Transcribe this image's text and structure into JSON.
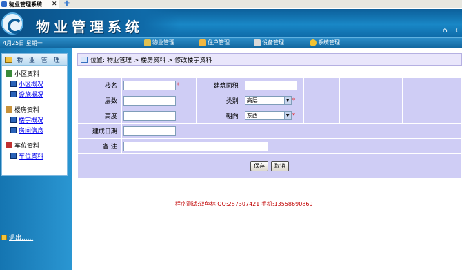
{
  "tab": {
    "title": "物业管理系统"
  },
  "header": {
    "system_title": "物业管理系统"
  },
  "menubar": {
    "date": "4月25日 星期一",
    "items": [
      "物业管理",
      "住户管理",
      "设备管理",
      "系统管理"
    ]
  },
  "sidebar": {
    "title": "物 业 管 理",
    "groups": [
      {
        "label": "小区资料",
        "items": [
          "小区概况",
          "设施概况"
        ]
      },
      {
        "label": "楼房资料",
        "items": [
          "楼宇概况",
          "房间信息"
        ]
      },
      {
        "label": "车位资料",
        "items": [
          "车位资料"
        ]
      }
    ],
    "logout": "退出......"
  },
  "breadcrumb": "位置: 物业管理 > 楼房资料 > 修改楼宇资料",
  "form": {
    "name_label": "楼名",
    "name_value": "",
    "area_label": "建筑面积",
    "area_value": "",
    "floors_label": "层数",
    "floors_value": "",
    "type_label": "类别",
    "type_value": "高层",
    "height_label": "高度",
    "height_value": "",
    "facing_label": "朝向",
    "facing_value": "东西",
    "built_label": "建成日期",
    "built_value": "",
    "note_label": "备 注",
    "note_value": "",
    "required_mark": "*",
    "save_label": "保存",
    "cancel_label": "取消"
  },
  "footer": "程序测试:双鱼林 QQ:287307421 手机:13558690869",
  "colors": {
    "accent": "#1879b8",
    "form_bg": "#cfcdf5",
    "footer_text": "#c00000"
  }
}
